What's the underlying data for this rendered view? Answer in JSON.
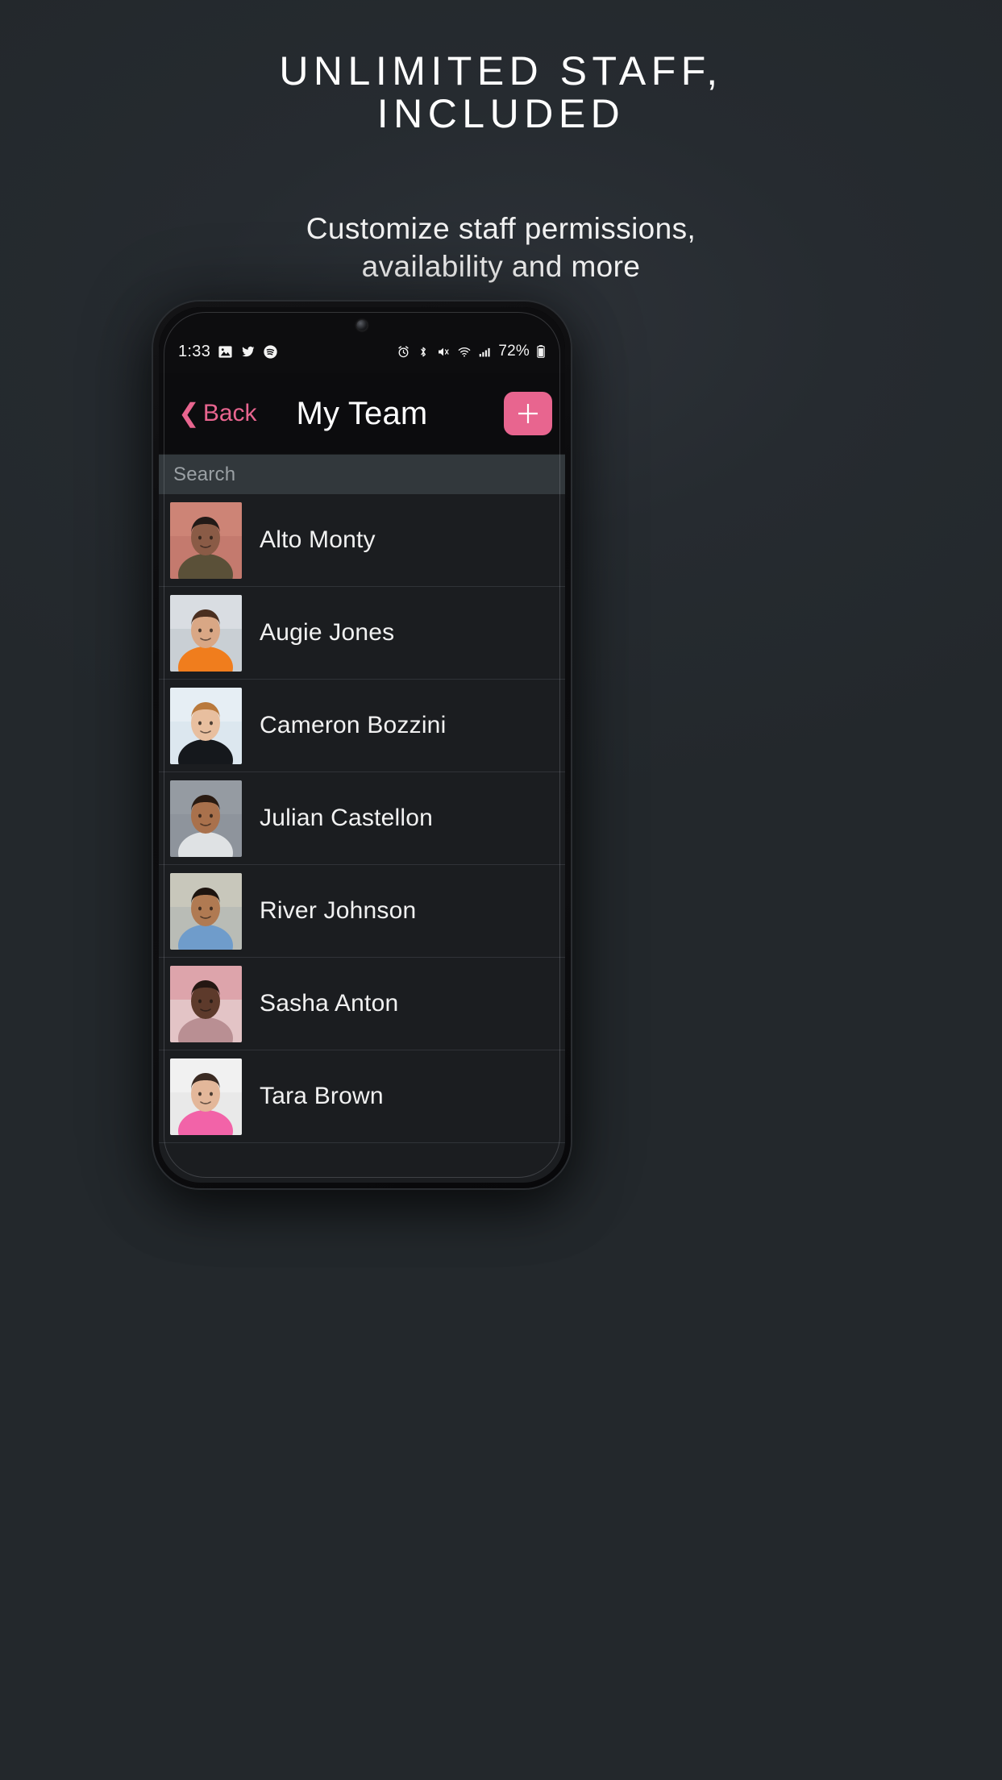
{
  "promo": {
    "headline_line1": "UNLIMITED STAFF,",
    "headline_line2": "INCLUDED",
    "subhead_line1": "Customize staff permissions,",
    "subhead_line2": "availability and more"
  },
  "colors": {
    "background": "#23282c",
    "accent_pink": "#e8658f",
    "app_background": "#1b1d20",
    "navbar": "#0c0c0e",
    "search_bar": "#32383c",
    "row_divider": "#303338",
    "text_primary": "#f1f1f1"
  },
  "phone": {
    "statusbar": {
      "time": "1:33",
      "battery_percent": "72%",
      "left_icons": [
        "photos-icon",
        "twitter-icon",
        "spotify-icon"
      ],
      "right_icons": [
        "alarm-icon",
        "bluetooth-icon",
        "mute-icon",
        "wifi-icon",
        "signal-icon",
        "battery-icon"
      ]
    },
    "camera": "punch-hole-camera"
  },
  "app": {
    "navbar": {
      "back_label": "Back",
      "back_icon": "chevron-left-icon",
      "title": "My Team",
      "add_icon": "plus-icon"
    },
    "search": {
      "placeholder": "Search",
      "value": ""
    },
    "team": [
      {
        "name": "Alto Monty",
        "avatar": "portrait-alto-monty",
        "bg": "#c47a6e",
        "skin": "#8a5b46",
        "hair": "#221a17",
        "top": "#5a5038",
        "accent": "#d58d7e"
      },
      {
        "name": "Augie Jones",
        "avatar": "portrait-augie-jones",
        "bg": "#c9cfd4",
        "skin": "#d9a785",
        "hair": "#4a2f20",
        "top": "#f07d1d",
        "accent": "#e6eaed"
      },
      {
        "name": "Cameron Bozzini",
        "avatar": "portrait-cameron-bozzini",
        "bg": "#dce7ef",
        "skin": "#e8bf9f",
        "hair": "#b9793c",
        "top": "#15181c",
        "accent": "#eef4f8"
      },
      {
        "name": "Julian Castellon",
        "avatar": "portrait-julian-castellon",
        "bg": "#8e949c",
        "skin": "#a9714c",
        "hair": "#2a1b12",
        "top": "#dfe2e4",
        "accent": "#9aa1a8"
      },
      {
        "name": "River Johnson",
        "avatar": "portrait-river-johnson",
        "bg": "#b9bcb6",
        "skin": "#b07a52",
        "hair": "#1d140f",
        "top": "#6f9ccb",
        "accent": "#d6cfc0"
      },
      {
        "name": "Sasha Anton",
        "avatar": "portrait-sasha-anton",
        "bg": "#e3c4c6",
        "skin": "#5d3a2b",
        "hair": "#241712",
        "top": "#b98f93",
        "accent": "#d98b96"
      },
      {
        "name": "Tara Brown",
        "avatar": "portrait-tara-brown",
        "bg": "#e9e9e9",
        "skin": "#e3b79a",
        "hair": "#3a2a22",
        "top": "#f263a8",
        "accent": "#f7f7f7"
      }
    ]
  }
}
